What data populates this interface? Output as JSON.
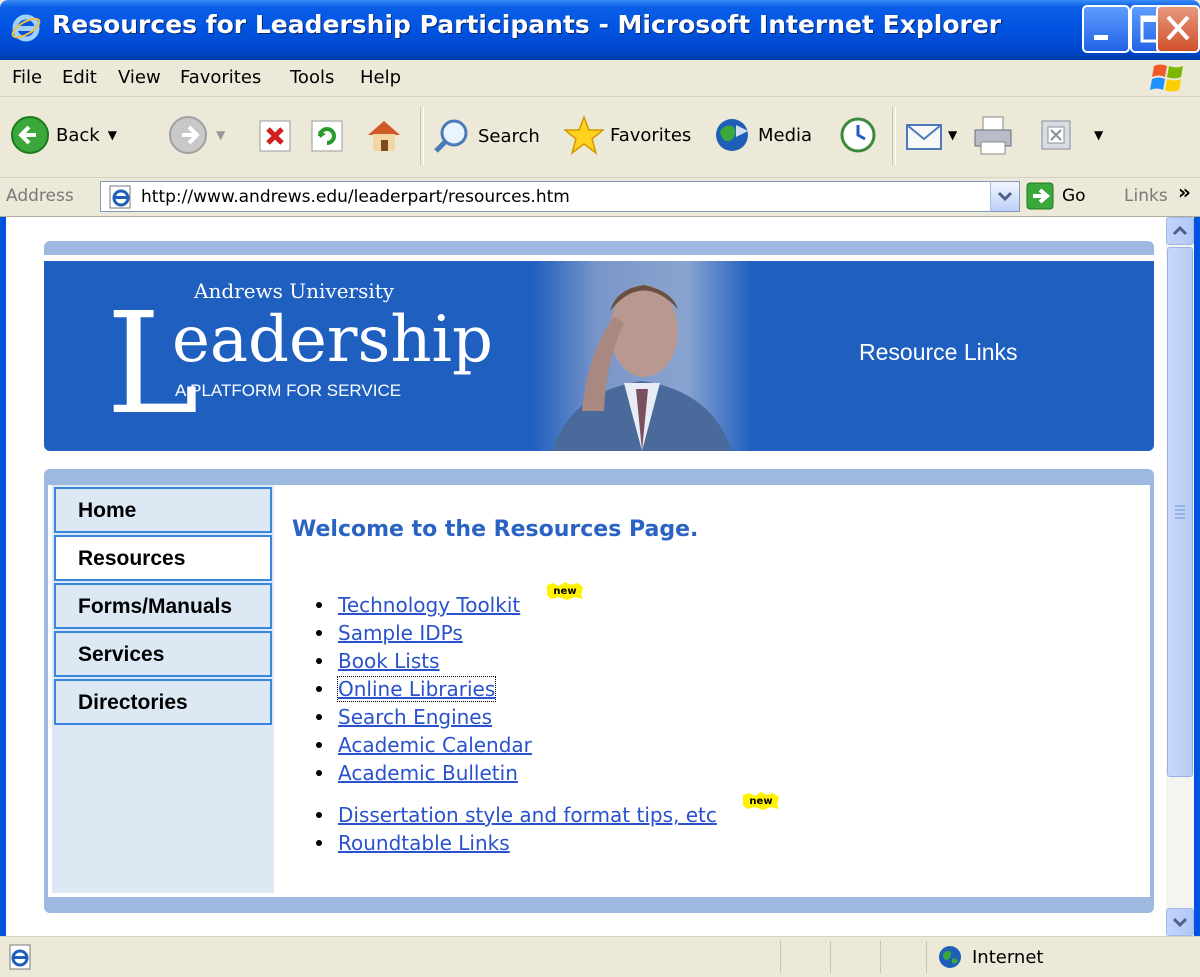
{
  "window": {
    "title": "Resources for Leadership Participants - Microsoft Internet Explorer"
  },
  "menu": [
    "File",
    "Edit",
    "View",
    "Favorites",
    "Tools",
    "Help"
  ],
  "toolbar": {
    "back_label": "Back",
    "search_label": "Search",
    "favorites_label": "Favorites",
    "media_label": "Media"
  },
  "address": {
    "label": "Address",
    "url": "http://www.andrews.edu/leaderpart/resources.htm",
    "go_label": "Go",
    "links_label": "Links"
  },
  "banner": {
    "university": "Andrews University",
    "logo_initial": "L",
    "logo_rest": "eadership",
    "tagline": "A PLATFORM FOR SERVICE",
    "section_title": "Resource Links"
  },
  "sidebar": {
    "items": [
      {
        "label": "Home",
        "active": false
      },
      {
        "label": "Resources",
        "active": true
      },
      {
        "label": "Forms/Manuals",
        "active": false
      },
      {
        "label": "Services",
        "active": false
      },
      {
        "label": "Directories",
        "active": false
      }
    ]
  },
  "main": {
    "heading": "Welcome to the Resources Page.",
    "links": [
      {
        "label": "Technology Toolkit",
        "new": true
      },
      {
        "label": "Sample IDPs",
        "new": false
      },
      {
        "label": "Book Lists",
        "new": false
      },
      {
        "label": "Online Libraries",
        "new": false,
        "focused": true
      },
      {
        "label": "Search Engines",
        "new": false
      },
      {
        "label": "Academic Calendar",
        "new": false
      },
      {
        "label": "Academic Bulletin",
        "new": false
      },
      {
        "label": "Dissertation style and format tips, etc",
        "new": true
      },
      {
        "label": "Roundtable Links",
        "new": false
      }
    ],
    "new_badge_text": "new"
  },
  "status": {
    "zone": "Internet"
  },
  "colors": {
    "banner_blue": "#1e5fc0",
    "strip_blue": "#9db9e0",
    "link_blue": "#2952cc",
    "heading_blue": "#2a63c4",
    "nav_border": "#3a85e0",
    "nav_bg": "#dde8f5"
  }
}
